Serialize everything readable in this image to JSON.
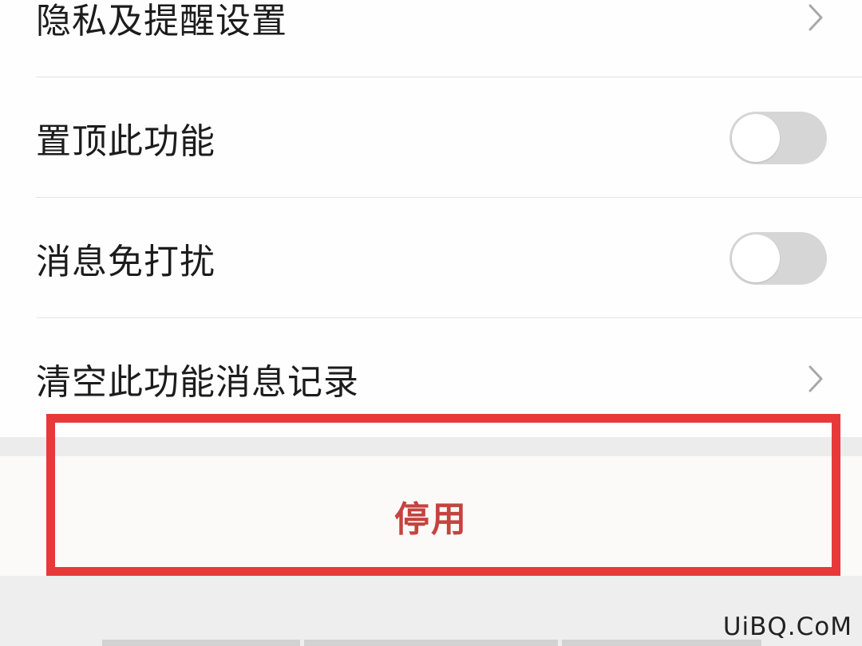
{
  "settings": {
    "items": [
      {
        "label": "隐私及提醒设置",
        "control": "chevron"
      },
      {
        "label": "置顶此功能",
        "control": "toggle",
        "state": "off"
      },
      {
        "label": "消息免打扰",
        "control": "toggle",
        "state": "off"
      },
      {
        "label": "清空此功能消息记录",
        "control": "chevron"
      }
    ]
  },
  "actions": {
    "disable_label": "停用"
  },
  "watermark": {
    "text": "UiBQ.CoM"
  },
  "colors": {
    "disable_text": "#c4433f",
    "highlight_border": "#e8393a",
    "toggle_off": "#d6d6d6"
  }
}
